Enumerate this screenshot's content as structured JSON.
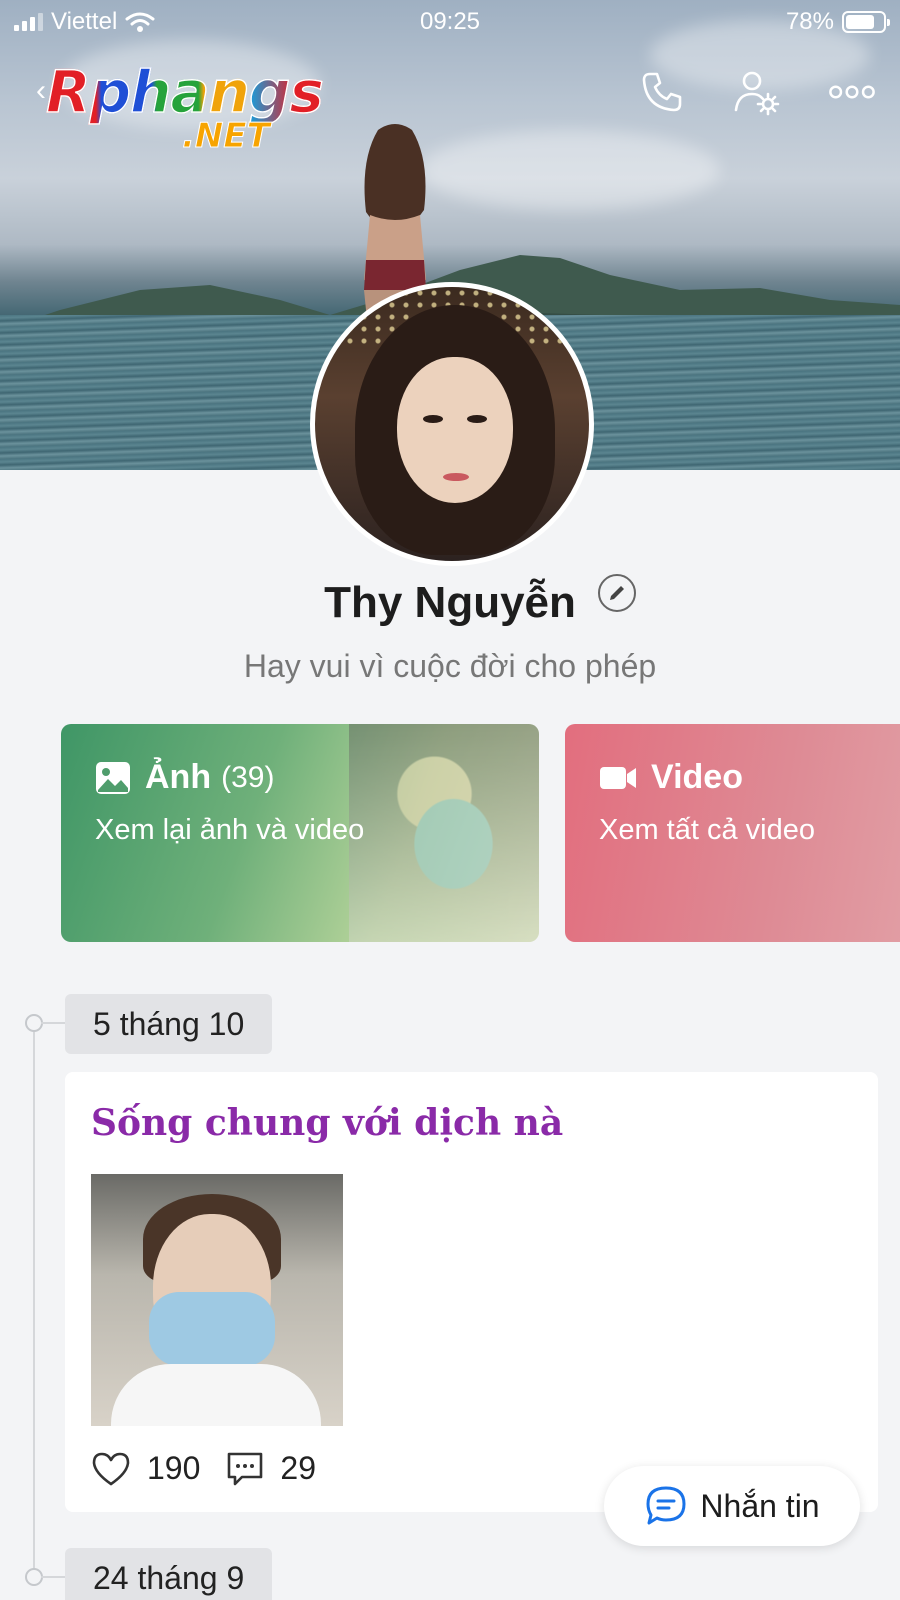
{
  "status_bar": {
    "carrier": "Viettel",
    "time": "09:25",
    "battery": "78%",
    "battery_level": 0.78
  },
  "watermark": {
    "line1": "Rphangs",
    "line2": ".NET"
  },
  "header": {
    "icons": [
      "back-chevron-icon",
      "phone-icon",
      "user-settings-icon",
      "more-icon"
    ]
  },
  "profile": {
    "name": "Thy Nguyễn",
    "status": "Hay vui vì cuộc đời cho phép"
  },
  "cards": {
    "photos": {
      "title": "Ảnh",
      "count": "(39)",
      "subtitle": "Xem lại ảnh và video"
    },
    "videos": {
      "title": "Video",
      "subtitle": "Xem tất cả video"
    }
  },
  "timeline": {
    "entries": [
      {
        "date": "5 tháng 10",
        "post": {
          "title": "Sống chung với dịch nà",
          "likes": "190",
          "comments": "29"
        }
      },
      {
        "date": "24 tháng 9"
      }
    ]
  },
  "fab": {
    "label": "Nhắn tin"
  },
  "colors": {
    "photos_card": "#3f9666",
    "videos_card": "#e26e7e",
    "post_title": "#8a2aa8",
    "chat_icon": "#1a73e8"
  }
}
